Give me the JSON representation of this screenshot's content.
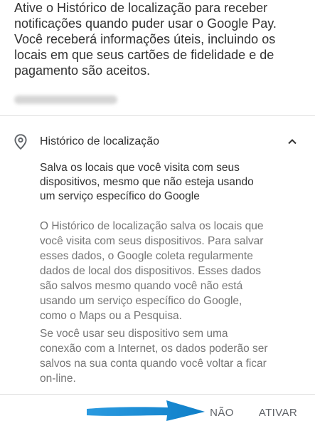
{
  "intro": {
    "text": "Ative o Histórico de localização para receber\nnotificações quando puder usar o Google Pay.\nVocê receberá informações úteis, incluindo os\nlocais em que seus cartões de fidelidade e de\npagamento são aceitos."
  },
  "account": {
    "email": "",
    "redacted": true
  },
  "location_history": {
    "icon": "location-pin-icon",
    "title": "Histórico de localização",
    "expanded": true,
    "expand_icon": "chevron-up-icon",
    "summary": "Salva os locais que você visita com seus\ndispositivos, mesmo que não esteja usando\num serviço específico do Google",
    "details_1": "O Histórico de localização salva os locais que\nvocê visita com seus dispositivos. Para salvar\nesses dados, o Google coleta regularmente\ndados de local dos dispositivos. Esses dados\nsão salvos mesmo quando você não está\nusando um serviço específico do Google,\ncomo o Maps ou a Pesquisa.",
    "details_2": "Se você usar seu dispositivo sem uma\nconexão com a Internet, os dados poderão ser\nsalvos na sua conta quando você voltar a ficar\non-line."
  },
  "actions": {
    "decline_label": "NÃO",
    "accept_label": "ATIVAR"
  },
  "annotation": {
    "arrow_color": "#1a8fd6",
    "points_to": "decline-button"
  },
  "colors": {
    "primary_text": "#333333",
    "secondary_text": "#757575",
    "button_text": "#5f6368",
    "divider": "#e2e2e2"
  }
}
